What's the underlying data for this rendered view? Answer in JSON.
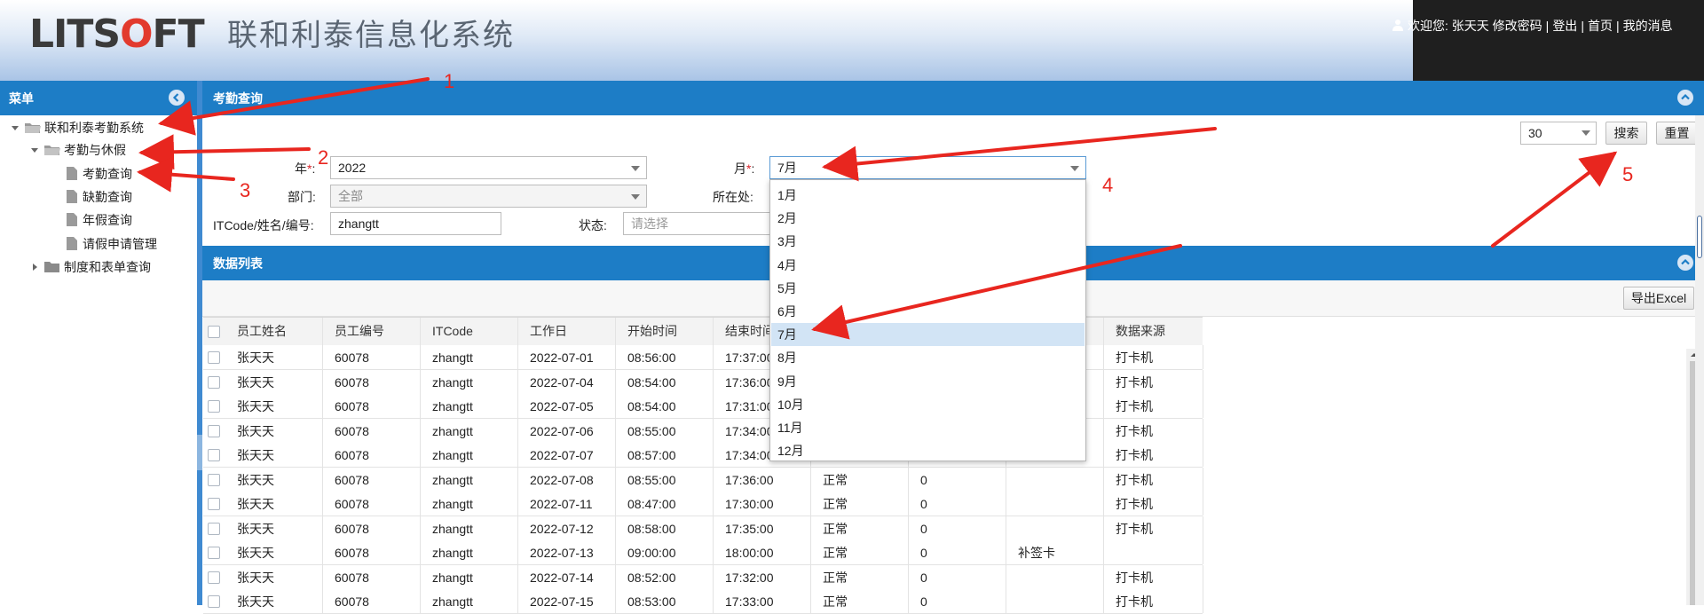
{
  "header": {
    "logo_prefix": "LITS",
    "logo_o": "O",
    "logo_suffix": "FT",
    "system_name": "联和利泰信息化系统",
    "welcome": "欢迎您:",
    "user_name": "张天天",
    "links": [
      "修改密码",
      "登出",
      "首页",
      "我的消息"
    ]
  },
  "menu": {
    "title": "菜单",
    "tree": {
      "root": "联和利泰考勤系统",
      "group1": "考勤与休假",
      "items": [
        "考勤查询",
        "缺勤查询",
        "年假查询",
        "请假申请管理"
      ],
      "group2": "制度和表单查询"
    }
  },
  "query_panel": {
    "title": "考勤查询",
    "page_size": "30",
    "search_label": "搜索",
    "reset_label": "重置",
    "year_label": "年",
    "year_value": "2022",
    "month_label": "月",
    "month_value": "7月",
    "dept_label": "部门:",
    "dept_value": "全部",
    "location_label": "所在处:",
    "code_label": "ITCode/姓名/编号:",
    "code_value": "zhangtt",
    "status_label": "状态:",
    "status_placeholder": "请选择",
    "required_mark": "*",
    "colon": ":"
  },
  "month_dropdown": {
    "options": [
      "1月",
      "2月",
      "3月",
      "4月",
      "5月",
      "6月",
      "7月",
      "8月",
      "9月",
      "10月",
      "11月",
      "12月"
    ],
    "selected_index": 6
  },
  "data_panel": {
    "title": "数据列表",
    "export_label": "导出Excel",
    "columns": [
      "员工姓名",
      "员工编号",
      "ITCode",
      "工作日",
      "开始时间",
      "结束时间",
      "",
      "",
      "",
      "数据来源"
    ],
    "rows": [
      [
        "张天天",
        "60078",
        "zhangtt",
        "2022-07-01",
        "08:56:00",
        "17:37:00",
        "",
        "",
        "",
        "打卡机"
      ],
      [
        "张天天",
        "60078",
        "zhangtt",
        "2022-07-04",
        "08:54:00",
        "17:36:00",
        "",
        "",
        "",
        "打卡机"
      ],
      [
        "张天天",
        "60078",
        "zhangtt",
        "2022-07-05",
        "08:54:00",
        "17:31:00",
        "",
        "",
        "",
        "打卡机"
      ],
      [
        "张天天",
        "60078",
        "zhangtt",
        "2022-07-06",
        "08:55:00",
        "17:34:00",
        "",
        "",
        "",
        "打卡机"
      ],
      [
        "张天天",
        "60078",
        "zhangtt",
        "2022-07-07",
        "08:57:00",
        "17:34:00",
        "",
        "",
        "",
        "打卡机"
      ],
      [
        "张天天",
        "60078",
        "zhangtt",
        "2022-07-08",
        "08:55:00",
        "17:36:00",
        "正常",
        "0",
        "",
        "打卡机"
      ],
      [
        "张天天",
        "60078",
        "zhangtt",
        "2022-07-11",
        "08:47:00",
        "17:30:00",
        "正常",
        "0",
        "",
        "打卡机"
      ],
      [
        "张天天",
        "60078",
        "zhangtt",
        "2022-07-12",
        "08:58:00",
        "17:35:00",
        "正常",
        "0",
        "",
        "打卡机"
      ],
      [
        "张天天",
        "60078",
        "zhangtt",
        "2022-07-13",
        "09:00:00",
        "18:00:00",
        "正常",
        "0",
        "补签卡",
        ""
      ],
      [
        "张天天",
        "60078",
        "zhangtt",
        "2022-07-14",
        "08:52:00",
        "17:32:00",
        "正常",
        "0",
        "",
        "打卡机"
      ],
      [
        "张天天",
        "60078",
        "zhangtt",
        "2022-07-15",
        "08:53:00",
        "17:33:00",
        "正常",
        "0",
        "",
        "打卡机"
      ]
    ]
  },
  "annotations": [
    "1",
    "2",
    "3",
    "4",
    "5"
  ],
  "colors": {
    "accent": "#1d7dc6",
    "annotation": "#e8261f",
    "selected": "#d2e4f5"
  }
}
